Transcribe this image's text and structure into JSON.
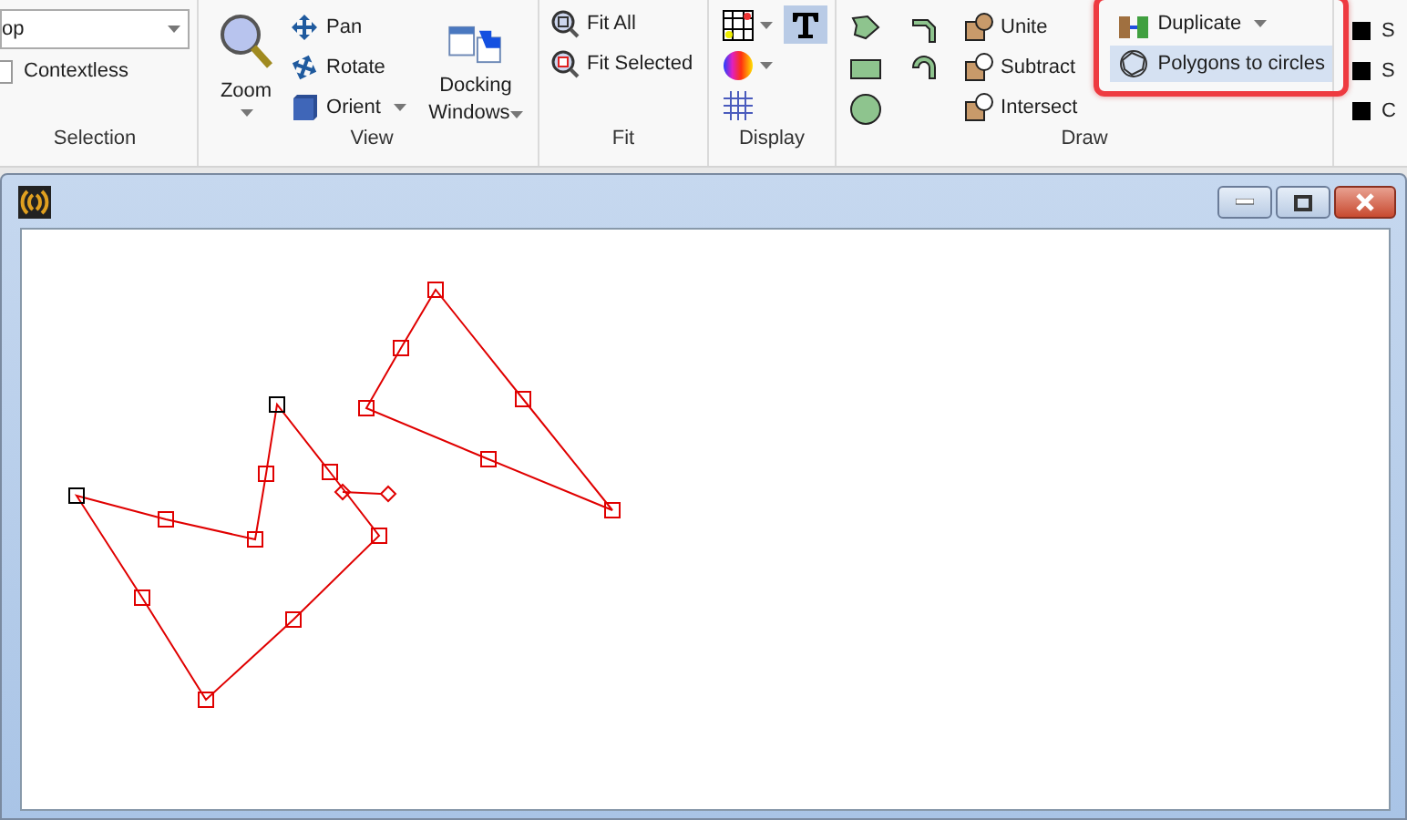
{
  "ribbon": {
    "selection": {
      "dropdown_value": "op",
      "checkbox": {
        "label": "Contextless",
        "checked": false
      },
      "label": "Selection"
    },
    "view": {
      "zoom": "Zoom",
      "pan": "Pan",
      "rotate": "Rotate",
      "orient": "Orient",
      "docking": "Docking Windows",
      "label": "View"
    },
    "fit": {
      "items": [
        "Fit All",
        "Fit Selected"
      ],
      "label": "Fit"
    },
    "display": {
      "text_toggle": {
        "selected": true
      },
      "label": "Display"
    },
    "draw": {
      "booleans": [
        "Unite",
        "Subtract",
        "Intersect"
      ],
      "tools": [
        {
          "label": "Duplicate",
          "selected": false
        },
        {
          "label": "Polygons to circles",
          "selected": true
        }
      ],
      "label": "Draw"
    },
    "edge_items": [
      "S",
      "S",
      "C"
    ]
  },
  "highlight": {
    "on": true
  }
}
